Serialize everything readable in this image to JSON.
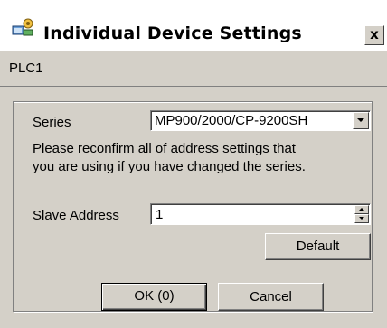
{
  "window": {
    "title": "Individual Device Settings",
    "close_label": "x"
  },
  "header": {
    "device": "PLC1"
  },
  "form": {
    "series_label": "Series",
    "series_value": "MP900/2000/CP-9200SH",
    "note_line1": "Please reconfirm all of address settings that",
    "note_line2": "you are using if you have changed the series.",
    "slave_address_label": "Slave Address",
    "slave_address_value": "1"
  },
  "buttons": {
    "default_label": "Default",
    "ok_label": "OK (0)",
    "cancel_label": "Cancel"
  },
  "icons": {
    "title": "device-settings-icon",
    "close": "close-icon",
    "dropdown": "chevron-down-icon",
    "spin_up": "spin-up-icon",
    "spin_down": "spin-down-icon"
  }
}
